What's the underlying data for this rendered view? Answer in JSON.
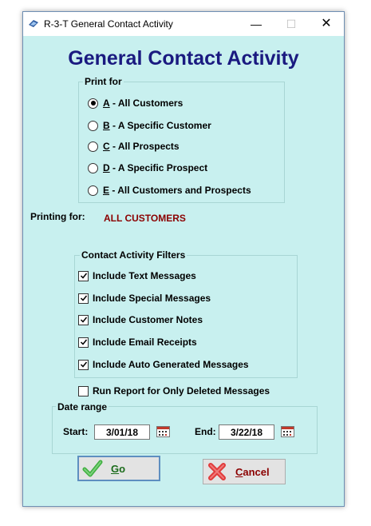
{
  "window": {
    "title": "R-3-T General Contact Activity",
    "minimize_glyph": "—",
    "maximize_glyph": "☐",
    "close_glyph": "✕"
  },
  "heading": "General Contact Activity",
  "print_for": {
    "title": "Print for",
    "options": [
      {
        "key": "A",
        "text": " - All Customers",
        "selected": true
      },
      {
        "key": "B",
        "text": " - A Specific Customer",
        "selected": false
      },
      {
        "key": "C",
        "text": " - All Prospects",
        "selected": false
      },
      {
        "key": "D",
        "text": " - A Specific Prospect",
        "selected": false
      },
      {
        "key": "E",
        "text": " - All Customers and Prospects",
        "selected": false
      }
    ]
  },
  "printing_for": {
    "label": "Printing for:",
    "value": "ALL CUSTOMERS"
  },
  "filters": {
    "title": "Contact Activity Filters",
    "items": [
      {
        "label": "Include Text Messages",
        "checked": true
      },
      {
        "label": "Include Special Messages",
        "checked": true
      },
      {
        "label": "Include Customer Notes",
        "checked": true
      },
      {
        "label": "Include Email Receipts",
        "checked": true
      },
      {
        "label": "Include Auto Generated Messages",
        "checked": true
      }
    ]
  },
  "deleted_only": {
    "label": "Run Report for Only Deleted Messages",
    "checked": false
  },
  "date_range": {
    "title": "Date range",
    "start_label": "Start:",
    "start_value": "3/01/18",
    "end_label": "End:",
    "end_value": "3/22/18"
  },
  "buttons": {
    "go_label_u": "G",
    "go_label_rest": "o",
    "cancel_label_u": "C",
    "cancel_label_rest": "ancel"
  },
  "colors": {
    "background": "#c8f0ef",
    "heading": "#1a1a80",
    "printing_value": "#8b0000",
    "go_icon": "#3fae3f",
    "cancel_icon": "#e03a3a"
  }
}
